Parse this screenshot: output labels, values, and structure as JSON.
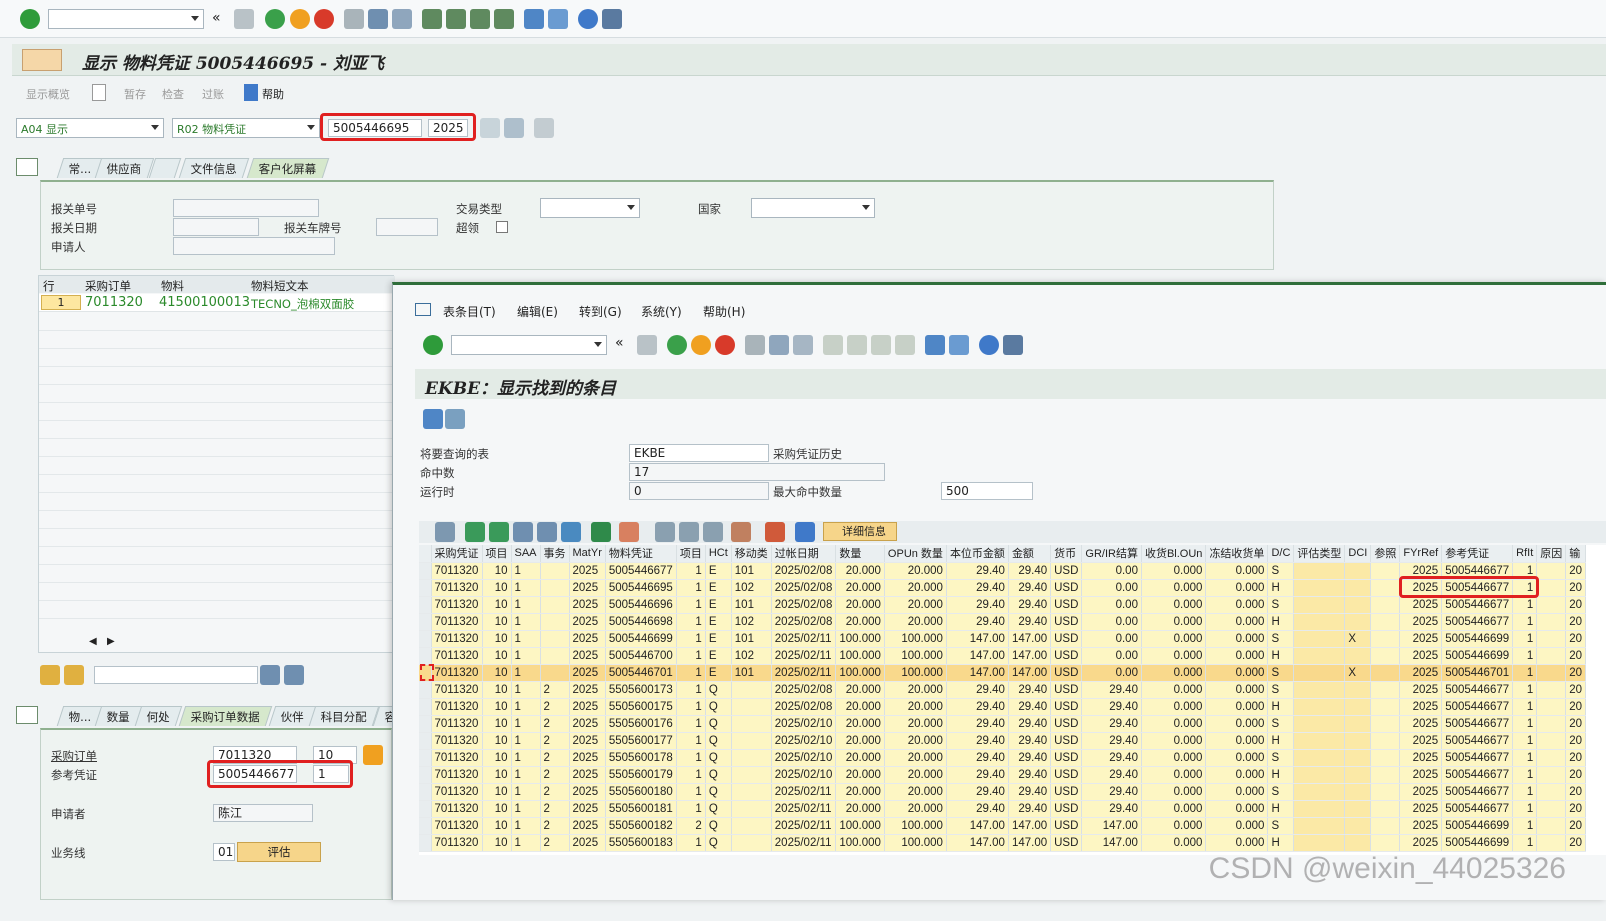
{
  "main_toolbar": {
    "command_field": ""
  },
  "title": {
    "text": "显示 物料凭证 5005446695 - 刘亚飞"
  },
  "app_toolbar": {
    "items": [
      "显示概览",
      "暂存",
      "检查",
      "过账",
      "帮助"
    ]
  },
  "selection": {
    "action": "A04 显示",
    "doc_type": "R02 物料凭证",
    "doc_number": "5005446695",
    "year": "2025"
  },
  "header_tabs": [
    "常...",
    "供应商",
    "文件信息",
    "客户化屏幕"
  ],
  "header_fields": {
    "customs_no_label": "报关单号",
    "customs_date_label": "报关日期",
    "plate_label": "报关车牌号",
    "applicant_label": "申请人",
    "trade_type_label": "交易类型",
    "country_label": "国家",
    "over_label": "超领"
  },
  "item_overview": {
    "columns": [
      "行",
      "采购订单",
      "物料",
      "物料短文本"
    ],
    "rows": [
      {
        "line": "1",
        "po": "7011320",
        "material": "41500100013",
        "text": "TECNO_泡棉双面胶"
      }
    ]
  },
  "detail_tabs": [
    "物...",
    "数量",
    "何处",
    "采购订单数据",
    "伙伴",
    "科目分配",
    "容"
  ],
  "detail_fields": {
    "po_label": "采购订单",
    "po_value": "7011320",
    "po_item": "10",
    "ref_label": "参考凭证",
    "ref_value": "5005446677",
    "ref_item": "1",
    "requester_label": "申请者",
    "requester_value": "陈江",
    "bizline_label": "业务线",
    "bizline_value": "01",
    "eval_button": "评估"
  },
  "popup": {
    "menu": [
      "表条目(T)",
      "编辑(E)",
      "转到(G)",
      "系统(Y)",
      "帮助(H)"
    ],
    "title": "EKBE：显示找到的条目",
    "table_label": "将要查询的表",
    "table_value": "EKBE",
    "table_desc": "采购凭证历史",
    "hits_label": "命中数",
    "hits_value": "17",
    "runtime_label": "运行时",
    "runtime_value": "0",
    "max_label": "最大命中数量",
    "max_value": "500",
    "detail_btn": "详细信息"
  },
  "ekbe": {
    "columns": [
      "采购凭证",
      "项目",
      "SAA",
      "事务",
      "MatYr",
      "物料凭证",
      "项目",
      "HCt",
      "移动类",
      "过帐日期",
      "数量",
      "OPUn 数量",
      "本位币金额",
      "金额",
      "货币",
      "GR/IR结算",
      "收货Bl.OUn",
      "冻结收货单",
      "D/C",
      "评估类型",
      "DCI",
      "参照",
      "FYrRef",
      "参考凭证",
      "RfIt",
      "原因",
      "输"
    ],
    "rows": [
      [
        "7011320",
        "10",
        "1",
        "",
        "2025",
        "5005446677",
        "1",
        "E",
        "101",
        "2025/02/08",
        "20.000",
        "20.000",
        "29.40",
        "29.40",
        "USD",
        "0.00",
        "0.000",
        "0.000",
        "S",
        "",
        "",
        "",
        "2025",
        "5005446677",
        "1",
        "",
        "20"
      ],
      [
        "7011320",
        "10",
        "1",
        "",
        "2025",
        "5005446695",
        "1",
        "E",
        "102",
        "2025/02/08",
        "20.000",
        "20.000",
        "29.40",
        "29.40",
        "USD",
        "0.00",
        "0.000",
        "0.000",
        "H",
        "",
        "",
        "",
        "2025",
        "5005446677",
        "1",
        "",
        "20"
      ],
      [
        "7011320",
        "10",
        "1",
        "",
        "2025",
        "5005446696",
        "1",
        "E",
        "101",
        "2025/02/08",
        "20.000",
        "20.000",
        "29.40",
        "29.40",
        "USD",
        "0.00",
        "0.000",
        "0.000",
        "S",
        "",
        "",
        "",
        "2025",
        "5005446677",
        "1",
        "",
        "20"
      ],
      [
        "7011320",
        "10",
        "1",
        "",
        "2025",
        "5005446698",
        "1",
        "E",
        "102",
        "2025/02/08",
        "20.000",
        "20.000",
        "29.40",
        "29.40",
        "USD",
        "0.00",
        "0.000",
        "0.000",
        "H",
        "",
        "",
        "",
        "2025",
        "5005446677",
        "1",
        "",
        "20"
      ],
      [
        "7011320",
        "10",
        "1",
        "",
        "2025",
        "5005446699",
        "1",
        "E",
        "101",
        "2025/02/11",
        "100.000",
        "100.000",
        "147.00",
        "147.00",
        "USD",
        "0.00",
        "0.000",
        "0.000",
        "S",
        "",
        "X",
        "",
        "2025",
        "5005446699",
        "1",
        "",
        "20"
      ],
      [
        "7011320",
        "10",
        "1",
        "",
        "2025",
        "5005446700",
        "1",
        "E",
        "102",
        "2025/02/11",
        "100.000",
        "100.000",
        "147.00",
        "147.00",
        "USD",
        "0.00",
        "0.000",
        "0.000",
        "H",
        "",
        "",
        "",
        "2025",
        "5005446699",
        "1",
        "",
        "20"
      ],
      [
        "7011320",
        "10",
        "1",
        "",
        "2025",
        "5005446701",
        "1",
        "E",
        "101",
        "2025/02/11",
        "100.000",
        "100.000",
        "147.00",
        "147.00",
        "USD",
        "0.00",
        "0.000",
        "0.000",
        "S",
        "",
        "X",
        "",
        "2025",
        "5005446701",
        "1",
        "",
        "20"
      ],
      [
        "7011320",
        "10",
        "1",
        "2",
        "2025",
        "5505600173",
        "1",
        "Q",
        "",
        "2025/02/08",
        "20.000",
        "20.000",
        "29.40",
        "29.40",
        "USD",
        "29.40",
        "0.000",
        "0.000",
        "S",
        "",
        "",
        "",
        "2025",
        "5005446677",
        "1",
        "",
        "20"
      ],
      [
        "7011320",
        "10",
        "1",
        "2",
        "2025",
        "5505600175",
        "1",
        "Q",
        "",
        "2025/02/08",
        "20.000",
        "20.000",
        "29.40",
        "29.40",
        "USD",
        "29.40",
        "0.000",
        "0.000",
        "H",
        "",
        "",
        "",
        "2025",
        "5005446677",
        "1",
        "",
        "20"
      ],
      [
        "7011320",
        "10",
        "1",
        "2",
        "2025",
        "5505600176",
        "1",
        "Q",
        "",
        "2025/02/10",
        "20.000",
        "20.000",
        "29.40",
        "29.40",
        "USD",
        "29.40",
        "0.000",
        "0.000",
        "S",
        "",
        "",
        "",
        "2025",
        "5005446677",
        "1",
        "",
        "20"
      ],
      [
        "7011320",
        "10",
        "1",
        "2",
        "2025",
        "5505600177",
        "1",
        "Q",
        "",
        "2025/02/10",
        "20.000",
        "20.000",
        "29.40",
        "29.40",
        "USD",
        "29.40",
        "0.000",
        "0.000",
        "H",
        "",
        "",
        "",
        "2025",
        "5005446677",
        "1",
        "",
        "20"
      ],
      [
        "7011320",
        "10",
        "1",
        "2",
        "2025",
        "5505600178",
        "1",
        "Q",
        "",
        "2025/02/10",
        "20.000",
        "20.000",
        "29.40",
        "29.40",
        "USD",
        "29.40",
        "0.000",
        "0.000",
        "S",
        "",
        "",
        "",
        "2025",
        "5005446677",
        "1",
        "",
        "20"
      ],
      [
        "7011320",
        "10",
        "1",
        "2",
        "2025",
        "5505600179",
        "1",
        "Q",
        "",
        "2025/02/10",
        "20.000",
        "20.000",
        "29.40",
        "29.40",
        "USD",
        "29.40",
        "0.000",
        "0.000",
        "H",
        "",
        "",
        "",
        "2025",
        "5005446677",
        "1",
        "",
        "20"
      ],
      [
        "7011320",
        "10",
        "1",
        "2",
        "2025",
        "5505600180",
        "1",
        "Q",
        "",
        "2025/02/11",
        "20.000",
        "20.000",
        "29.40",
        "29.40",
        "USD",
        "29.40",
        "0.000",
        "0.000",
        "S",
        "",
        "",
        "",
        "2025",
        "5005446677",
        "1",
        "",
        "20"
      ],
      [
        "7011320",
        "10",
        "1",
        "2",
        "2025",
        "5505600181",
        "1",
        "Q",
        "",
        "2025/02/11",
        "20.000",
        "20.000",
        "29.40",
        "29.40",
        "USD",
        "29.40",
        "0.000",
        "0.000",
        "H",
        "",
        "",
        "",
        "2025",
        "5005446677",
        "1",
        "",
        "20"
      ],
      [
        "7011320",
        "10",
        "1",
        "2",
        "2025",
        "5505600182",
        "2",
        "Q",
        "",
        "2025/02/11",
        "100.000",
        "100.000",
        "147.00",
        "147.00",
        "USD",
        "147.00",
        "0.000",
        "0.000",
        "S",
        "",
        "",
        "",
        "2025",
        "5005446699",
        "1",
        "",
        "20"
      ],
      [
        "7011320",
        "10",
        "1",
        "2",
        "2025",
        "5505600183",
        "1",
        "Q",
        "",
        "2025/02/11",
        "100.000",
        "100.000",
        "147.00",
        "147.00",
        "USD",
        "147.00",
        "0.000",
        "0.000",
        "H",
        "",
        "",
        "",
        "2025",
        "5005446699",
        "1",
        "",
        "20"
      ]
    ],
    "highlighted_row": 6
  },
  "watermark": "CSDN @weixin_44025326",
  "colors": {
    "highlight": "#f9d98c",
    "red_box": "#e02020",
    "yellow_cell": "#fdf6c3"
  }
}
